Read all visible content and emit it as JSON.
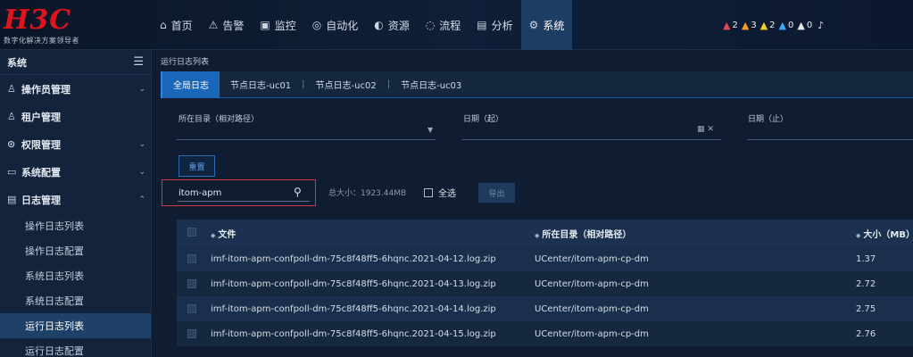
{
  "logo": {
    "mark": "H3C",
    "subtitle": "数字化解决方案领导者"
  },
  "nav": [
    {
      "icon": "⌂",
      "icon_name": "home-icon",
      "label": "首页"
    },
    {
      "icon": "⚠",
      "icon_name": "alarm-icon",
      "label": "告警"
    },
    {
      "icon": "▣",
      "icon_name": "monitor-icon",
      "label": "监控"
    },
    {
      "icon": "◎",
      "icon_name": "automation-icon",
      "label": "自动化"
    },
    {
      "icon": "◐",
      "icon_name": "resource-icon",
      "label": "资源"
    },
    {
      "icon": "◌",
      "icon_name": "process-icon",
      "label": "流程"
    },
    {
      "icon": "▤",
      "icon_name": "analysis-icon",
      "label": "分析"
    },
    {
      "icon": "⚙",
      "icon_name": "system-icon",
      "label": "系统"
    }
  ],
  "alerts": [
    {
      "color": "#e5484d",
      "count": "2"
    },
    {
      "color": "#f59a23",
      "count": "3"
    },
    {
      "color": "#f2d023",
      "count": "2"
    },
    {
      "color": "#3ea8ff",
      "count": "0"
    },
    {
      "color": "#e6e6e6",
      "count": "0"
    }
  ],
  "sidebar": {
    "title": "系统",
    "items": [
      {
        "icon": "♙",
        "label": "操作员管理"
      },
      {
        "icon": "♙",
        "label": "租户管理"
      },
      {
        "icon": "⊙",
        "label": "权限管理"
      },
      {
        "icon": "▭",
        "label": "系统配置"
      },
      {
        "icon": "▤",
        "label": "日志管理"
      }
    ],
    "subitems": [
      "操作日志列表",
      "操作日志配置",
      "系统日志列表",
      "系统日志配置",
      "运行日志列表",
      "运行日志配置"
    ]
  },
  "main": {
    "breadcrumb": "运行日志列表",
    "tabs": [
      "全局日志",
      "节点日志-uc01",
      "节点日志-uc02",
      "节点日志-uc03"
    ],
    "filters": {
      "dir_label": "所在目录（相对路径）",
      "start_label": "日期（起）",
      "end_label": "日期（止）"
    },
    "reset_label": "重置",
    "search_value": "itom-apm",
    "total_size": "总大小：1923.44MB",
    "select_all": "全选",
    "export_label": "导出",
    "table": {
      "headers": {
        "file": "文件",
        "dir": "所在目录（相对路径）",
        "size": "大小（MB）"
      },
      "rows": [
        {
          "file": "imf-itom-apm-confpoll-dm-75c8f48ff5-6hqnc.2021-04-12.log.zip",
          "dir": "UCenter/itom-apm-cp-dm",
          "size": "1.37"
        },
        {
          "file": "imf-itom-apm-confpoll-dm-75c8f48ff5-6hqnc.2021-04-13.log.zip",
          "dir": "UCenter/itom-apm-cp-dm",
          "size": "2.72"
        },
        {
          "file": "imf-itom-apm-confpoll-dm-75c8f48ff5-6hqnc.2021-04-14.log.zip",
          "dir": "UCenter/itom-apm-cp-dm",
          "size": "2.75"
        },
        {
          "file": "imf-itom-apm-confpoll-dm-75c8f48ff5-6hqnc.2021-04-15.log.zip",
          "dir": "UCenter/itom-apm-cp-dm",
          "size": "2.76"
        }
      ]
    }
  }
}
